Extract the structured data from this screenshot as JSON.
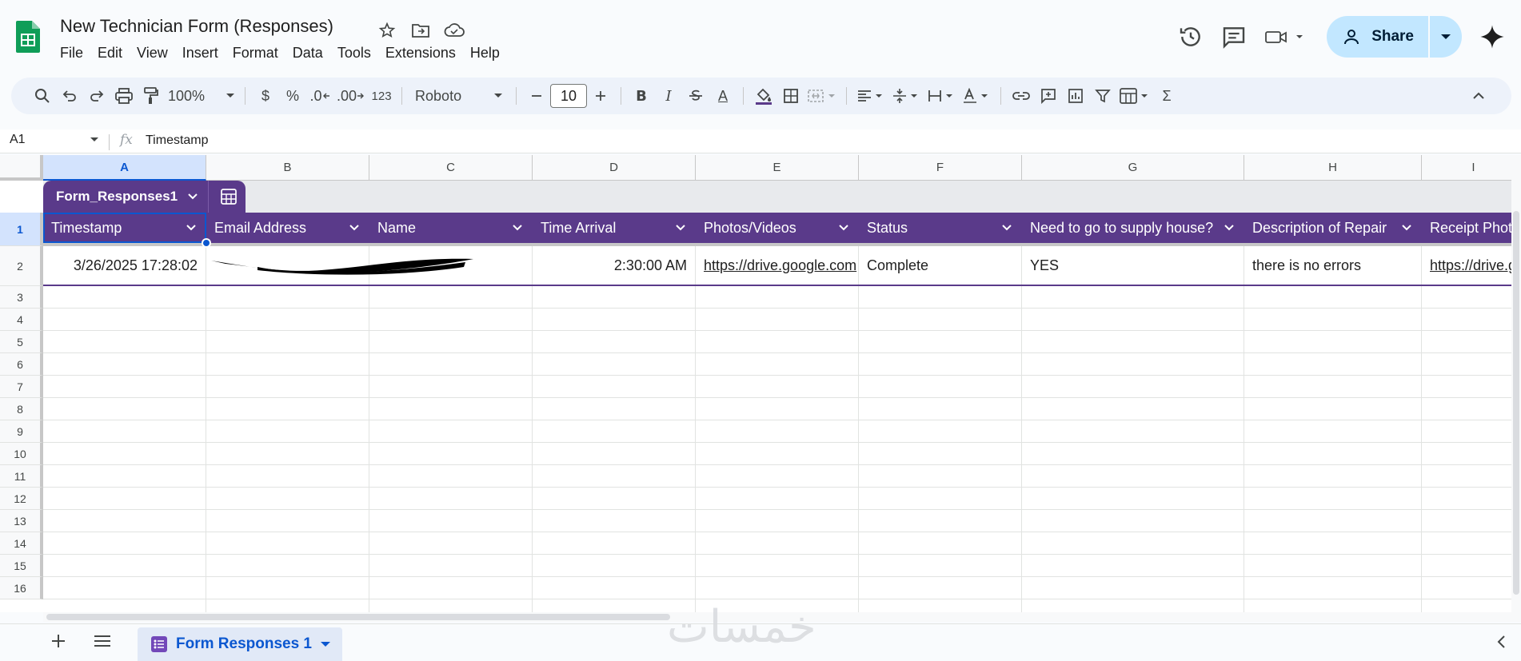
{
  "app": {
    "doc_title": "New Technician Form (Responses)",
    "menu": [
      "File",
      "Edit",
      "View",
      "Insert",
      "Format",
      "Data",
      "Tools",
      "Extensions",
      "Help"
    ],
    "share_label": "Share"
  },
  "toolbar": {
    "zoom": "100%",
    "currency": "$",
    "percent": "%",
    "dec_decrease": ".0",
    "dec_increase": ".00",
    "number_format": "123",
    "font": "Roboto",
    "font_size": "10",
    "bold": "B",
    "italic": "I",
    "text_color": "A",
    "sum": "Σ"
  },
  "formula_bar": {
    "cell_ref": "A1",
    "fx": "fx",
    "value": "Timestamp"
  },
  "grid": {
    "columns": [
      "A",
      "B",
      "C",
      "D",
      "E",
      "F",
      "G",
      "H",
      "I"
    ],
    "rows": [
      "1",
      "2",
      "3",
      "4",
      "5",
      "6",
      "7",
      "8",
      "9",
      "10",
      "11",
      "12",
      "13",
      "14",
      "15",
      "16"
    ],
    "table_name": "Form_Responses1",
    "headers": [
      "Timestamp",
      "Email Address",
      "Name",
      "Time Arrival",
      "Photos/Videos",
      "Status",
      "Need to go to supply house?",
      "Description of Repair",
      "Receipt Photo"
    ],
    "row2": [
      "3/26/2025 17:28:02",
      "",
      "",
      "2:30:00 AM",
      "https://drive.google.com",
      "Complete",
      "YES",
      "there is no errors",
      "https://drive.g"
    ]
  },
  "sheets": {
    "active_tab": "Form Responses 1"
  },
  "colors": {
    "table_header": "#5a3a8a",
    "selection": "#0b57d0",
    "share_bg": "#c2e7ff"
  }
}
